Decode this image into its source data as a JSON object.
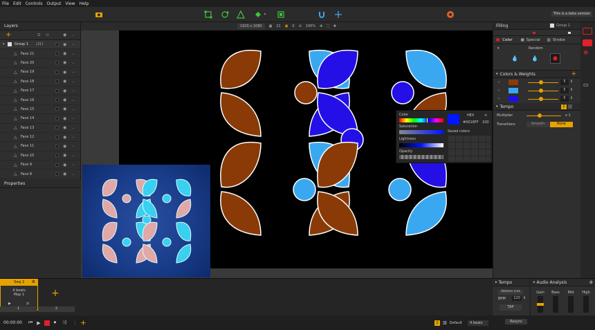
{
  "menu": [
    "File",
    "Edit",
    "Controls",
    "Output",
    "View",
    "Help"
  ],
  "toolbar": {
    "beta": "This is a beta version"
  },
  "layers": {
    "title": "Layers",
    "group": "Group 1",
    "group_count": "(21)",
    "faces": [
      "Face 21",
      "Face 20",
      "Face 19",
      "Face 18",
      "Face 17",
      "Face 16",
      "Face 15",
      "Face 14",
      "Face 13",
      "Face 12",
      "Face 11",
      "Face 10",
      "Face 9",
      "Face 8"
    ]
  },
  "properties": {
    "title": "Properties"
  },
  "canvasbar": {
    "resolution": "1920 x 1080",
    "n1": "21",
    "n2": "0",
    "zoom": "100%"
  },
  "filling": {
    "title": "Filling",
    "group": "Group 1",
    "tabs": [
      "Color",
      "Special",
      "Strobe"
    ],
    "random_label": "Random",
    "weights_title": "Colors & Weights",
    "weights": [
      {
        "color": "#8a3a06",
        "value": "5"
      },
      {
        "color": "#3aa8f0",
        "value": "5"
      },
      {
        "color": "#1d10e6",
        "value": "5"
      }
    ],
    "tempo_title": "Tempo",
    "multiplier_label": "Multiplier",
    "multiplier_value": "x 1",
    "transitions_label": "Transitions",
    "smooth": "Smooth",
    "none": "None"
  },
  "picker": {
    "color_label": "Color",
    "hex_label": "HEX",
    "hex_value": "#0016FF",
    "alpha": "100",
    "saturation": "Saturation",
    "saved": "Saved colors",
    "lightness": "Lightness",
    "opacity": "Opacity"
  },
  "sequence": {
    "name": "Seq 1",
    "beats": "4 beats",
    "map": "Map 1",
    "slot1": "1",
    "slot2": "2"
  },
  "transport": {
    "time": "00:00:00",
    "default": "Default",
    "beats": "4 beats"
  },
  "tempo_panel": {
    "title": "Tempo",
    "link": "Ableton Link",
    "bpm_label": "BPM",
    "bpm": "120",
    "tap": "TAP",
    "resync": "Resync"
  },
  "audio": {
    "title": "Audio Analysis",
    "channels": [
      "Gain",
      "Bass",
      "Mid",
      "High"
    ]
  },
  "colors": {
    "brown": "#8a3a06",
    "light_blue": "#3aa8f0",
    "blue": "#2410e6",
    "accent": "#e6a200",
    "red": "#e0202a"
  }
}
